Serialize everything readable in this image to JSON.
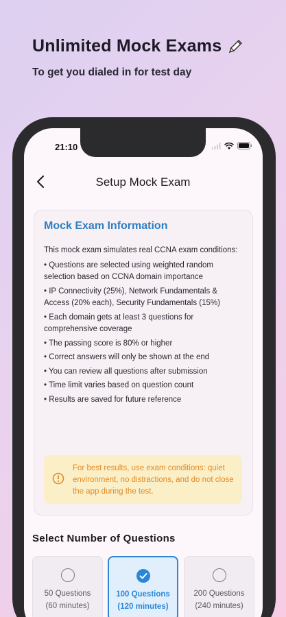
{
  "promo": {
    "title": "Unlimited Mock Exams",
    "subtitle": "To get you dialed in for test day",
    "title_icon": "pencil-icon"
  },
  "status_bar": {
    "time": "21:10",
    "icons": [
      "signal-icon",
      "wifi-icon",
      "battery-icon"
    ]
  },
  "header": {
    "back_icon": "chevron-left-icon",
    "title": "Setup Mock Exam"
  },
  "info": {
    "heading": "Mock Exam Information",
    "intro": "This mock exam simulates real CCNA exam conditions:",
    "bullets": [
      "• Questions are selected using weighted random selection based on CCNA domain importance",
      "• IP Connectivity (25%), Network Fundamentals & Access (20% each), Security Fundamentals (15%)",
      "• Each domain gets at least 3 questions for comprehensive coverage",
      "• The passing score is 80% or higher",
      "• Correct answers will only be shown at the end",
      "• You can review all questions after submission",
      "• Time limit varies based on question count",
      "• Results are saved for future reference"
    ],
    "warning": "For best results, use exam conditions: quiet environment, no distractions, and do not close the app during the test."
  },
  "question_select": {
    "title": "Select Number of Questions",
    "options": [
      {
        "questions": "50 Questions",
        "time": "(60 minutes)",
        "selected": false
      },
      {
        "questions": "100 Questions",
        "time": "(120 minutes)",
        "selected": true
      },
      {
        "questions": "200 Questions",
        "time": "(240 minutes)",
        "selected": false
      }
    ]
  },
  "colors": {
    "accent": "#2b86d8",
    "heading_blue": "#2e7ec2",
    "warning_bg": "#fbefc8",
    "warning_text": "#e48a23"
  }
}
